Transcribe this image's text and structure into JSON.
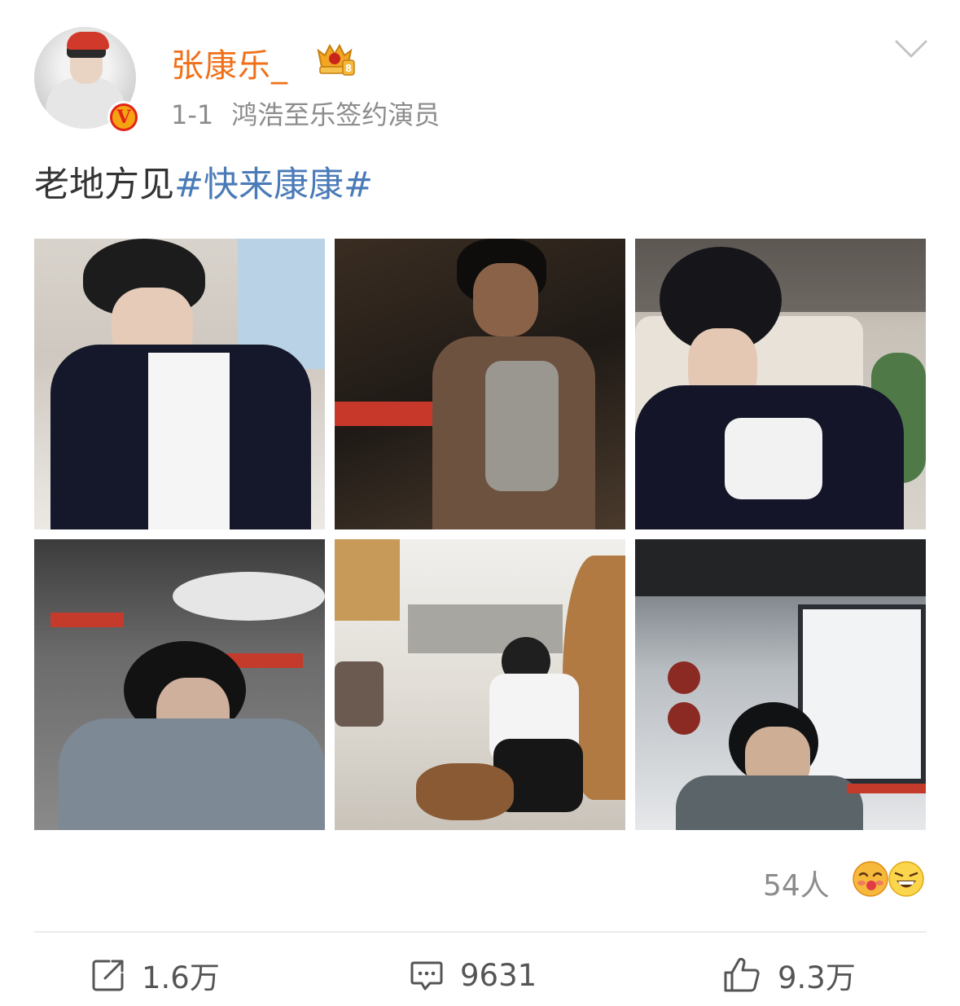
{
  "post": {
    "author": {
      "name": "张康乐_",
      "avatar_icon": "avatar",
      "verified_icon": "verified-v-icon",
      "badge_icon": "crown-level-badge-icon",
      "badge_level": "8",
      "meta_time": "1-1",
      "meta_desc": "鸿浩至乐签约演员",
      "verified_letter": "V"
    },
    "menu_icon": "chevron-down-icon",
    "text": {
      "plain": "老地方见",
      "hashtag": "#快来康康#"
    },
    "images": [
      {
        "name": "photo-1"
      },
      {
        "name": "photo-2"
      },
      {
        "name": "photo-3"
      },
      {
        "name": "photo-4"
      },
      {
        "name": "photo-5"
      },
      {
        "name": "photo-6"
      }
    ],
    "reactions": {
      "count_label": "54人",
      "emojis": [
        "kiss-emoji-icon",
        "laugh-emoji-icon"
      ]
    },
    "actions": {
      "repost": {
        "icon": "share-icon",
        "label": "1.6万"
      },
      "comment": {
        "icon": "comment-icon",
        "label": "9631"
      },
      "like": {
        "icon": "thumbs-up-icon",
        "label": "9.3万"
      }
    }
  },
  "colors": {
    "username": "#f0701a",
    "hashtag": "#4a7bb8",
    "meta": "#8c8c8c"
  }
}
